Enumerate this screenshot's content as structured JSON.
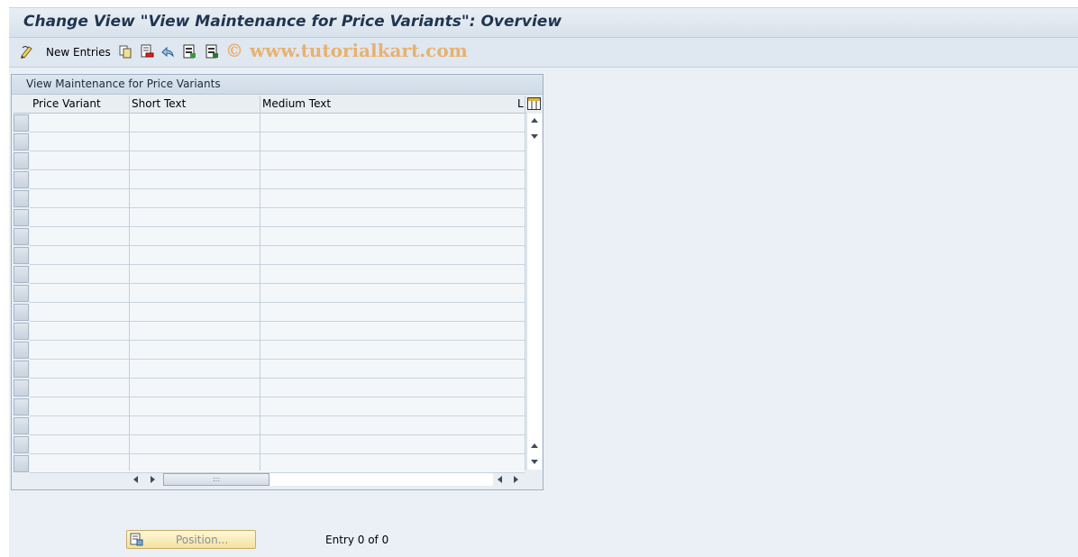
{
  "window": {
    "title": "Change View \"View Maintenance for Price Variants\": Overview"
  },
  "toolbar": {
    "new_entries_label": "New Entries",
    "icons": [
      "edit-pencil-icon",
      "copy-icon",
      "delete-icon",
      "undo-icon",
      "select-all-icon",
      "deselect-all-icon"
    ],
    "watermark": "© www.tutorialkart.com"
  },
  "table": {
    "title": "View Maintenance for Price Variants",
    "columns": [
      "Price Variant",
      "Short Text",
      "Medium Text",
      "L"
    ],
    "rows": [
      [
        "",
        "",
        ""
      ],
      [
        "",
        "",
        ""
      ],
      [
        "",
        "",
        ""
      ],
      [
        "",
        "",
        ""
      ],
      [
        "",
        "",
        ""
      ],
      [
        "",
        "",
        ""
      ],
      [
        "",
        "",
        ""
      ],
      [
        "",
        "",
        ""
      ],
      [
        "",
        "",
        ""
      ],
      [
        "",
        "",
        ""
      ],
      [
        "",
        "",
        ""
      ],
      [
        "",
        "",
        ""
      ],
      [
        "",
        "",
        ""
      ],
      [
        "",
        "",
        ""
      ],
      [
        "",
        "",
        ""
      ],
      [
        "",
        "",
        ""
      ],
      [
        "",
        "",
        ""
      ],
      [
        "",
        "",
        ""
      ],
      [
        "",
        "",
        ""
      ]
    ]
  },
  "footer": {
    "position_button_label": "Position...",
    "entry_info": "Entry 0 of 0"
  }
}
